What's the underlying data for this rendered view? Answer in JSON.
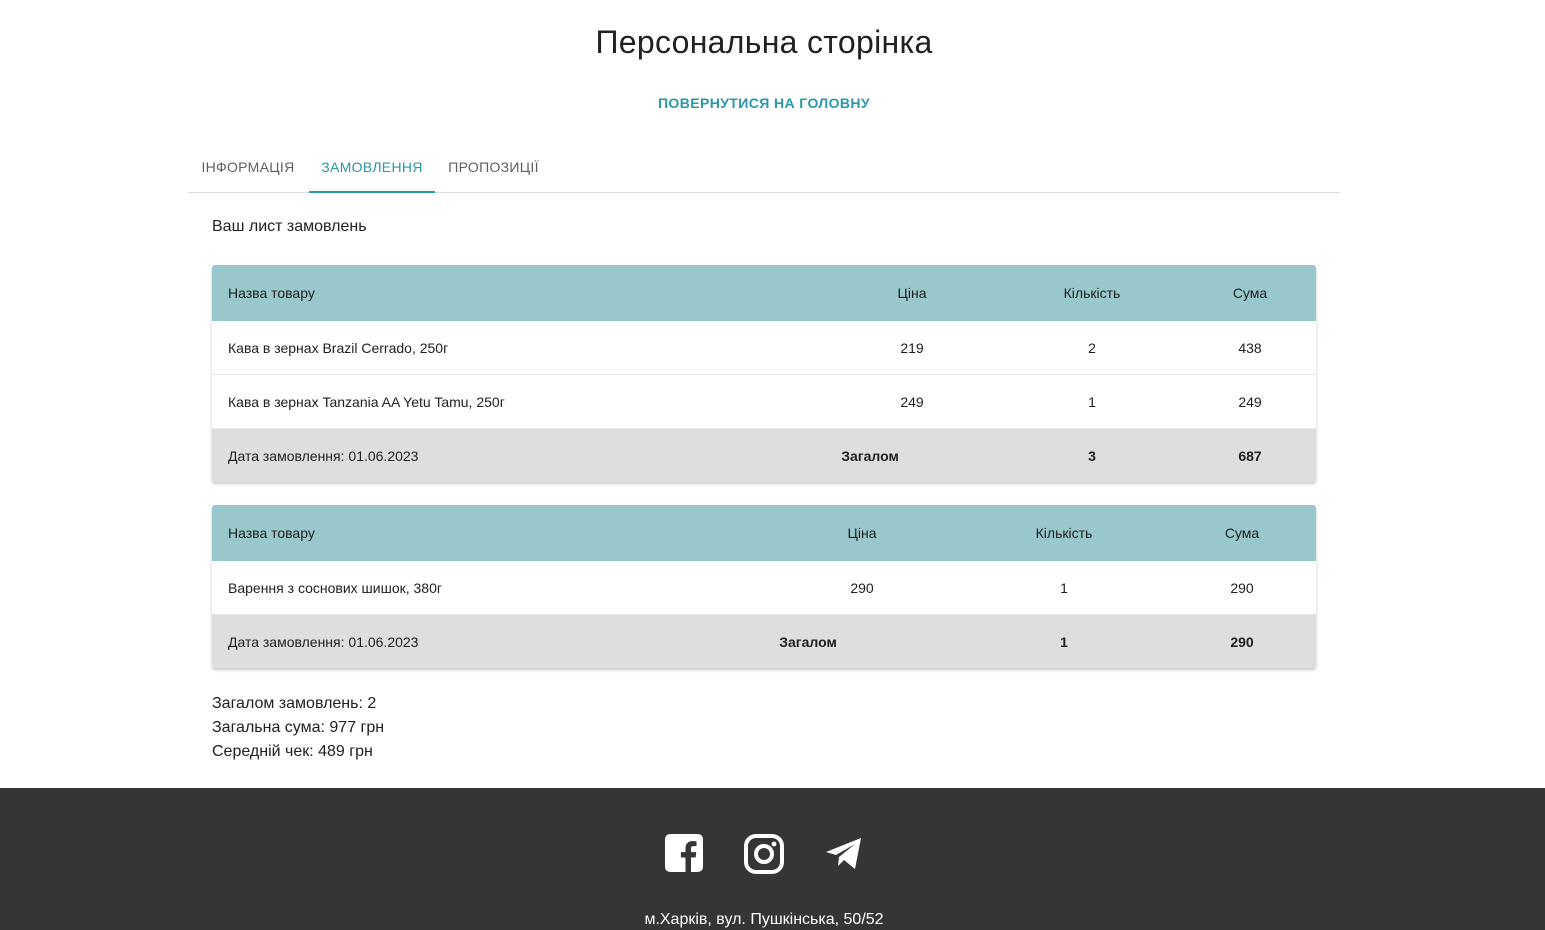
{
  "header": {
    "title": "Персональна сторінка",
    "back_link": "ПОВЕРНУТИСЯ НА ГОЛОВНУ"
  },
  "tabs": [
    {
      "label": "ІНФОРМАЦІЯ",
      "active": false
    },
    {
      "label": "ЗАМОВЛЕННЯ",
      "active": true
    },
    {
      "label": "ПРОПОЗИЦІЇ",
      "active": false
    }
  ],
  "orders_section": {
    "title": "Ваш лист замовлень",
    "columns": {
      "name": "Назва товару",
      "price": "Ціна",
      "qty": "Кількість",
      "sum": "Сума"
    },
    "orders": [
      {
        "items": [
          {
            "name": "Кава в зернах Brazil Cerrado, 250г",
            "price": "219",
            "qty": "2",
            "sum": "438"
          },
          {
            "name": "Кава в зернах Tanzania AA Yetu Tamu, 250г",
            "price": "249",
            "qty": "1",
            "sum": "249"
          }
        ],
        "date_label": "Дата замовлення: 01.06.2023",
        "total_label": "Загалом",
        "total_qty": "3",
        "total_sum": "687"
      },
      {
        "items": [
          {
            "name": "Варення з соснових шишок, 380г",
            "price": "290",
            "qty": "1",
            "sum": "290"
          }
        ],
        "date_label": "Дата замовлення: 01.06.2023",
        "total_label": "Загалом",
        "total_qty": "1",
        "total_sum": "290"
      }
    ]
  },
  "summary": {
    "orders_count": "Загалом замовлень: 2",
    "total_sum": "Загальна сума: 977 грн",
    "avg_check": "Середній чек: 489 грн"
  },
  "footer": {
    "social_icons": [
      "facebook-icon",
      "instagram-icon",
      "telegram-icon"
    ],
    "address": "м.Харків, вул. Пушкінська, 50/52"
  },
  "colors": {
    "accent": "#2b97a8",
    "table_header": "#98c7cc",
    "total_row": "#dedede",
    "footer_bg": "#353535"
  }
}
